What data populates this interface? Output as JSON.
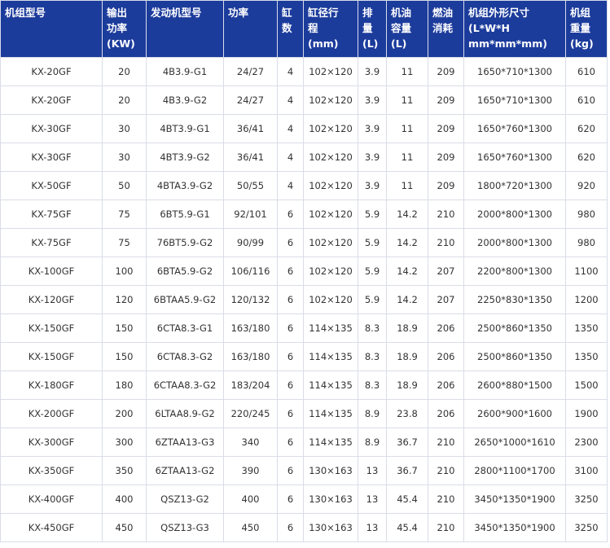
{
  "table": {
    "headers": [
      "机组型号",
      "输出\n功率\n(KW)",
      "发动机型号",
      "功率",
      "缸\n数",
      "缸径行\n程\n(mm)",
      "排\n量\n(L)",
      "机油\n容量\n(L)",
      "燃油\n消耗",
      "机组外形尺寸\n(L*W*H\nmm*mm*mm)",
      "机组\n重量\n(kg)"
    ],
    "rows": [
      [
        "KX-20GF",
        "20",
        "4B3.9-G1",
        "24/27",
        "4",
        "102×120",
        "3.9",
        "11",
        "209",
        "1650*710*1300",
        "610"
      ],
      [
        "KX-20GF",
        "20",
        "4B3.9-G2",
        "24/27",
        "4",
        "102×120",
        "3.9",
        "11",
        "209",
        "1650*710*1300",
        "610"
      ],
      [
        "KX-30GF",
        "30",
        "4BT3.9-G1",
        "36/41",
        "4",
        "102×120",
        "3.9",
        "11",
        "209",
        "1650*760*1300",
        "620"
      ],
      [
        "KX-30GF",
        "30",
        "4BT3.9-G2",
        "36/41",
        "4",
        "102×120",
        "3.9",
        "11",
        "209",
        "1650*760*1300",
        "620"
      ],
      [
        "KX-50GF",
        "50",
        "4BTA3.9-G2",
        "50/55",
        "4",
        "102×120",
        "3.9",
        "11",
        "209",
        "1800*720*1300",
        "920"
      ],
      [
        "KX-75GF",
        "75",
        "6BT5.9-G1",
        "92/101",
        "6",
        "102×120",
        "5.9",
        "14.2",
        "210",
        "2000*800*1300",
        "980"
      ],
      [
        "KX-75GF",
        "75",
        "76BT5.9-G2",
        "90/99",
        "6",
        "102×120",
        "5.9",
        "14.2",
        "210",
        "2000*800*1300",
        "980"
      ],
      [
        "KX-100GF",
        "100",
        "6BTA5.9-G2",
        "106/116",
        "6",
        "102×120",
        "5.9",
        "14.2",
        "207",
        "2200*800*1300",
        "1100"
      ],
      [
        "KX-120GF",
        "120",
        "6BTAA5.9-G2",
        "120/132",
        "6",
        "102×120",
        "5.9",
        "14.2",
        "207",
        "2250*830*1350",
        "1200"
      ],
      [
        "KX-150GF",
        "150",
        "6CTA8.3-G1",
        "163/180",
        "6",
        "114×135",
        "8.3",
        "18.9",
        "206",
        "2500*860*1350",
        "1350"
      ],
      [
        "KX-150GF",
        "150",
        "6CTA8.3-G2",
        "163/180",
        "6",
        "114×135",
        "8.3",
        "18.9",
        "206",
        "2500*860*1350",
        "1350"
      ],
      [
        "KX-180GF",
        "180",
        "6CTAA8.3-G2",
        "183/204",
        "6",
        "114×135",
        "8.3",
        "18.9",
        "206",
        "2600*880*1500",
        "1500"
      ],
      [
        "KX-200GF",
        "200",
        "6LTAA8.9-G2",
        "220/245",
        "6",
        "114×135",
        "8.9",
        "23.8",
        "206",
        "2600*900*1600",
        "1900"
      ],
      [
        "KX-300GF",
        "300",
        "6ZTAA13-G3",
        "340",
        "6",
        "114×135",
        "8.9",
        "36.7",
        "210",
        "2650*1000*1610",
        "2300"
      ],
      [
        "KX-350GF",
        "350",
        "6ZTAA13-G2",
        "390",
        "6",
        "130×163",
        "13",
        "36.7",
        "210",
        "2800*1100*1700",
        "3100"
      ],
      [
        "KX-400GF",
        "400",
        "QSZ13-G2",
        "400",
        "6",
        "130×163",
        "13",
        "45.4",
        "210",
        "3450*1350*1900",
        "3250"
      ],
      [
        "KX-450GF",
        "450",
        "QSZ13-G3",
        "450",
        "6",
        "130×163",
        "13",
        "45.4",
        "210",
        "3450*1350*1900",
        "3250"
      ]
    ]
  }
}
